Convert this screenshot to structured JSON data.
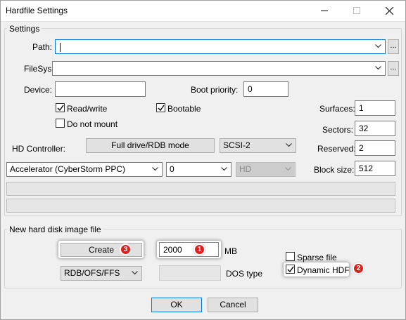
{
  "window": {
    "title": "Hardfile Settings"
  },
  "settings": {
    "group_title": "Settings",
    "path_label": "Path:",
    "path_value": "",
    "filesys_label": "FileSys:",
    "filesys_value": "",
    "browse_label": "...",
    "device_label": "Device:",
    "device_value": "",
    "boot_priority_label": "Boot priority:",
    "boot_priority_value": "0",
    "read_write_label": "Read/write",
    "read_write_checked": true,
    "bootable_label": "Bootable",
    "bootable_checked": true,
    "do_not_mount_label": "Do not mount",
    "do_not_mount_checked": false,
    "hd_controller_label": "HD Controller:",
    "full_drive_button": "Full drive/RDB mode",
    "controller_value": "SCSI-2",
    "accelerator_value": "Accelerator (CyberStorm PPC)",
    "unit_value": "0",
    "type_value": "HD",
    "surfaces_label": "Surfaces:",
    "surfaces_value": "1",
    "sectors_label": "Sectors:",
    "sectors_value": "32",
    "reserved_label": "Reserved:",
    "reserved_value": "2",
    "block_size_label": "Block size:",
    "block_size_value": "512"
  },
  "new_image": {
    "group_title": "New hard disk image file",
    "create_button": "Create",
    "size_value": "2000",
    "size_unit": "MB",
    "filesystem_value": "RDB/OFS/FFS",
    "dos_type_value": "",
    "dos_type_label": "DOS type",
    "sparse_label": "Sparse file",
    "sparse_checked": false,
    "dynamic_label": "Dynamic HDF",
    "dynamic_checked": true
  },
  "annotations": {
    "badge1": "1",
    "badge2": "2",
    "badge3": "3",
    "color": "#e0201b"
  },
  "footer": {
    "ok_label": "OK",
    "cancel_label": "Cancel"
  }
}
